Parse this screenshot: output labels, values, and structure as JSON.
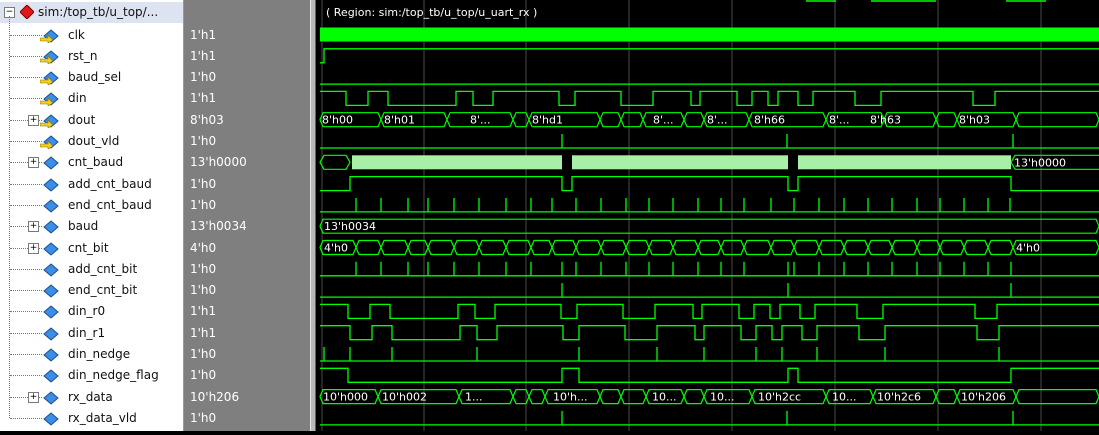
{
  "scope": {
    "name": "sim:/top_tb/u_top/...",
    "region_label": "( Region: sim:/top_tb/u_top/u_uart_rx )"
  },
  "colors": {
    "wave": "#00ff00",
    "bus_fill": "#a8f0a8",
    "grid": "#4a4a4a",
    "names_bg": "#ffffff",
    "values_bg": "#7f7f7f"
  },
  "signals": [
    {
      "name": "clk",
      "value": "1'h1",
      "kind": "clock",
      "icon": "signal-out-icon"
    },
    {
      "name": "rst_n",
      "value": "1'h1",
      "kind": "bit",
      "icon": "signal-out-icon"
    },
    {
      "name": "baud_sel",
      "value": "1'h0",
      "kind": "bit",
      "icon": "signal-out-icon"
    },
    {
      "name": "din",
      "value": "1'h1",
      "kind": "bit",
      "icon": "signal-out-icon"
    },
    {
      "name": "dout",
      "value": "8'h03",
      "kind": "bus",
      "expandable": true,
      "icon": "signal-bus-icon",
      "labels": [
        "8'h00",
        "8'h01",
        "8'...",
        "8'hd1",
        "8'...",
        "8'...",
        "8'h66",
        "8'...",
        "8'h63",
        "8'h03"
      ]
    },
    {
      "name": "dout_vld",
      "value": "1'h0",
      "kind": "bit",
      "icon": "signal-out-icon"
    },
    {
      "name": "cnt_baud",
      "value": "13'h0000",
      "kind": "dense",
      "expandable": true,
      "icon": "signal-internal-icon",
      "labels": [
        "13'h0000"
      ]
    },
    {
      "name": "add_cnt_baud",
      "value": "1'h0",
      "kind": "bit",
      "icon": "signal-internal-icon"
    },
    {
      "name": "end_cnt_baud",
      "value": "1'h0",
      "kind": "pulses",
      "icon": "signal-internal-icon"
    },
    {
      "name": "baud",
      "value": "13'h0034",
      "kind": "bus",
      "expandable": true,
      "icon": "signal-internal-icon",
      "labels": [
        "13'h0034"
      ]
    },
    {
      "name": "cnt_bit",
      "value": "4'h0",
      "kind": "bus",
      "expandable": true,
      "icon": "signal-internal-icon",
      "labels": [
        "4'h0",
        "4'h0"
      ]
    },
    {
      "name": "add_cnt_bit",
      "value": "1'h0",
      "kind": "pulses",
      "icon": "signal-internal-icon"
    },
    {
      "name": "end_cnt_bit",
      "value": "1'h0",
      "kind": "pulses",
      "icon": "signal-internal-icon"
    },
    {
      "name": "din_r0",
      "value": "1'h1",
      "kind": "bit",
      "icon": "signal-internal-icon"
    },
    {
      "name": "din_r1",
      "value": "1'h1",
      "kind": "bit",
      "icon": "signal-internal-icon"
    },
    {
      "name": "din_nedge",
      "value": "1'h0",
      "kind": "pulses",
      "icon": "signal-internal-icon"
    },
    {
      "name": "din_nedge_flag",
      "value": "1'h0",
      "kind": "bit",
      "icon": "signal-internal-icon"
    },
    {
      "name": "rx_data",
      "value": "10'h206",
      "kind": "bus",
      "expandable": true,
      "icon": "signal-internal-icon",
      "labels": [
        "10'h000",
        "10'h002",
        "1...",
        "10'h...",
        "10...",
        "10...",
        "10'h2cc",
        "10...",
        "10'h2c6",
        "10'h206"
      ]
    },
    {
      "name": "rx_data_vld",
      "value": "1'h0",
      "kind": "bit",
      "icon": "signal-internal-icon"
    }
  ]
}
